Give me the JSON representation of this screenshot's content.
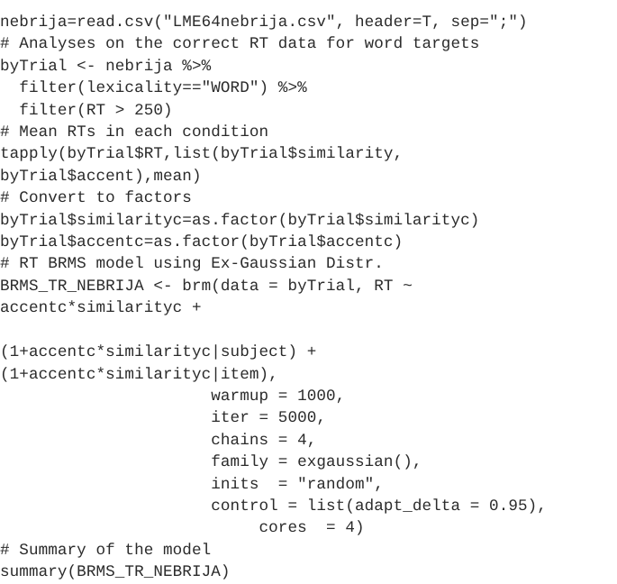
{
  "document": {
    "kind": "code-listing",
    "language": "R",
    "background_color": "#ffffff",
    "text_color": "#2b2b2b",
    "line_count": 24
  },
  "code": {
    "lines": [
      "nebrija=read.csv(\"LME64nebrija.csv\", header=T, sep=\";\")",
      "# Analyses on the correct RT data for word targets",
      "byTrial <- nebrija %>%",
      "  filter(lexicality==\"WORD\") %>%",
      "  filter(RT > 250)",
      "# Mean RTs in each condition",
      "tapply(byTrial$RT,list(byTrial$similarity,",
      "byTrial$accent),mean)",
      "# Convert to factors",
      "byTrial$similarityc=as.factor(byTrial$similarityc)",
      "byTrial$accentc=as.factor(byTrial$accentc)",
      "# RT BRMS model using Ex-Gaussian Distr.",
      "BRMS_TR_NEBRIJA <- brm(data = byTrial, RT ~",
      "accentc*similarityc +",
      "",
      "(1+accentc*similarityc|subject) +",
      "(1+accentc*similarityc|item),",
      "                      warmup = 1000,",
      "                      iter = 5000,",
      "                      chains = 4,",
      "                      family = exgaussian(),",
      "                      inits  = \"random\",",
      "                      control = list(adapt_delta = 0.95),",
      "                           cores  = 4)",
      "# Summary of the model",
      "summary(BRMS_TR_NEBRIJA)"
    ]
  }
}
